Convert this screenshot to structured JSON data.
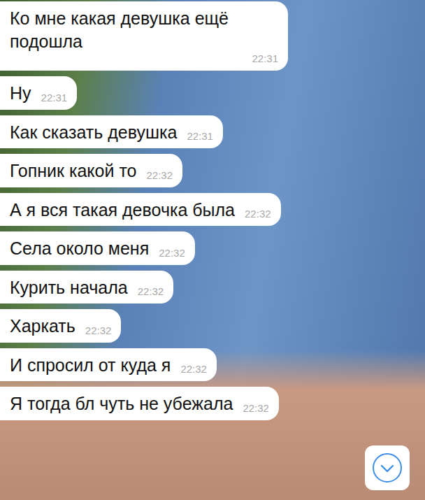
{
  "chat": {
    "messages": [
      {
        "text": "Ко мне какая девушка ещё подошла",
        "time": "22:31"
      },
      {
        "text": "Ну",
        "time": "22:31"
      },
      {
        "text": "Как сказать девушка",
        "time": "22:31"
      },
      {
        "text": "Гопник какой то",
        "time": "22:32"
      },
      {
        "text": "А я вся такая девочка была",
        "time": "22:32"
      },
      {
        "text": "Села около меня",
        "time": "22:32"
      },
      {
        "text": "Курить начала",
        "time": "22:32"
      },
      {
        "text": "Харкать",
        "time": "22:32"
      },
      {
        "text": "И спросил от куда я",
        "time": "22:32"
      },
      {
        "text": "Я тогда бл чуть не убежала",
        "time": "22:32"
      }
    ]
  }
}
